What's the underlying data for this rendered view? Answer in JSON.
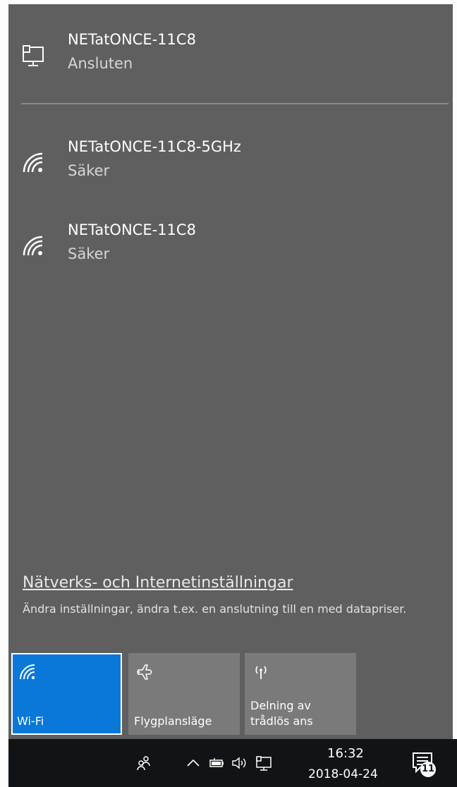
{
  "networks": [
    {
      "name": "NETatONCE-11C8",
      "status": "Ansluten",
      "icon": "ethernet-computer-icon"
    },
    {
      "name": "NETatONCE-11C8-5GHz",
      "status": "Säker",
      "icon": "wifi-signal-icon"
    },
    {
      "name": "NETatONCE-11C8",
      "status": "Säker",
      "icon": "wifi-signal-icon"
    }
  ],
  "settings": {
    "link_label": "Nätverks- och Internetinställningar",
    "description": "Ändra inställningar, ändra t.ex. en anslutning till en med datapriser."
  },
  "quick_actions": [
    {
      "label": "Wi-Fi",
      "active": true,
      "icon": "wifi-icon"
    },
    {
      "label": "Flygplansläge",
      "active": false,
      "icon": "airplane-icon"
    },
    {
      "label": "Delning av trådlös ans",
      "active": false,
      "icon": "hotspot-icon"
    }
  ],
  "taskbar": {
    "time": "16:32",
    "date": "2018-04-24",
    "notification_count": "11"
  },
  "colors": {
    "flyout_bg": "#5f5f5f",
    "accent": "#0a78d8",
    "tile_bg": "#7a7a7a",
    "taskbar_bg": "#101417"
  }
}
